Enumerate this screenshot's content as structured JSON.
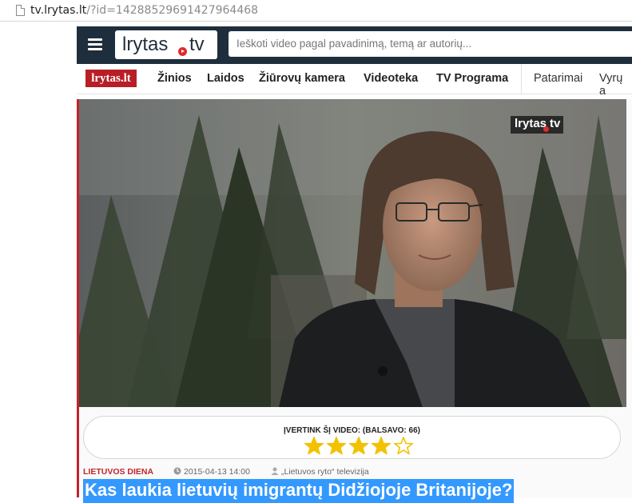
{
  "browser": {
    "url_host": "tv.lrytas.lt",
    "url_path": "/?id=14288529691427964468"
  },
  "header": {
    "logo_left": "lrytas",
    "logo_right": "tv",
    "search_placeholder": "Ieškoti video pagal pavadinimą, temą ar autorių..."
  },
  "nav": {
    "brand": "lrytas.lt",
    "items": [
      "Žinios",
      "Laidos",
      "Žiūrovų kamera",
      "Videoteka",
      "TV Programa"
    ],
    "extra": [
      "Patarimai",
      "Vyrų a"
    ]
  },
  "video": {
    "watermark_left": "lrytas",
    "watermark_right": "tv"
  },
  "rating": {
    "label": "ĮVERTINK ŠĮ VIDEO: (BALSAVO: 66)",
    "stars_filled": 4,
    "stars_total": 5,
    "star_color": "#f2c200"
  },
  "article": {
    "category": "LIETUVOS DIENA",
    "date": "2015-04-13 14:00",
    "author": "„Lietuvos ryto“ televizija",
    "title": "Kas laukia lietuvių imigrantų Didžiojoje Britanijoje?"
  },
  "colors": {
    "header_bg": "#1f2e3c",
    "brand_red": "#b81e25",
    "selection": "#3399ff"
  }
}
